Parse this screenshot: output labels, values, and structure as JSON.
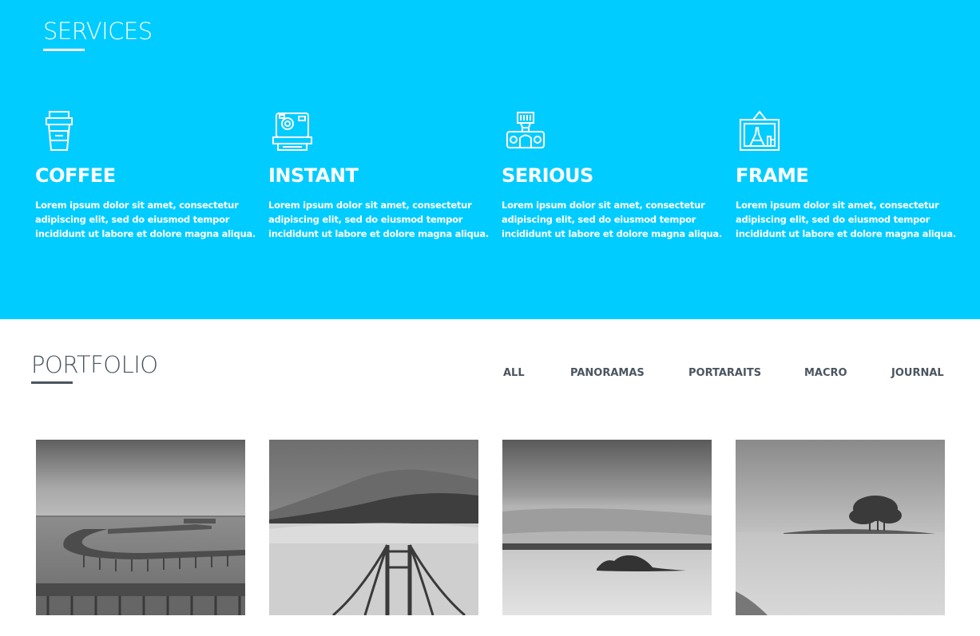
{
  "services": {
    "title": "SERVICES",
    "items": [
      {
        "icon": "coffee-cup-icon",
        "title": "COFFEE",
        "lines": [
          "Lorem ipsum dolor sit amet, consectetur",
          "adipiscing elit, sed do eiusmod tempor",
          "incididunt ut labore et dolore magna aliqua."
        ]
      },
      {
        "icon": "instant-camera-icon",
        "title": "INSTANT",
        "lines": [
          "Lorem ipsum dolor sit amet, consectetur",
          "adipiscing elit, sed do eiusmod tempor",
          "incididunt ut labore et dolore magna aliqua."
        ]
      },
      {
        "icon": "camera-flash-icon",
        "title": "SERIOUS",
        "lines": [
          "Lorem ipsum dolor sit amet, consectetur",
          "adipiscing elit, sed do eiusmod tempor",
          "incididunt ut labore et dolore magna aliqua."
        ]
      },
      {
        "icon": "picture-frame-icon",
        "title": "FRAME",
        "lines": [
          "Lorem ipsum dolor sit amet, consectetur",
          "adipiscing elit, sed do eiusmod tempor",
          "incididunt ut labore et dolore magna aliqua."
        ]
      }
    ]
  },
  "portfolio": {
    "title": "PORTFOLIO",
    "filters": [
      "ALL",
      "PANORAMAS",
      "PORTARAITS",
      "MACRO",
      "JOURNAL"
    ],
    "tiles": [
      "pier-photo",
      "golden-gate-fog-photo",
      "rock-seascape-photo",
      "island-tree-photo"
    ]
  },
  "colors": {
    "services_bg": "#00ccff",
    "text_dark": "#4b5560",
    "white": "#ffffff"
  }
}
